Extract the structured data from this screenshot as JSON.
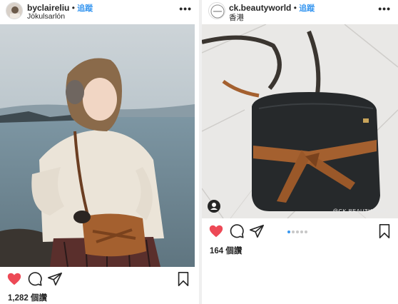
{
  "posts": [
    {
      "username": "byclaireliu",
      "follow_label": "追蹤",
      "location": "Jökulsarlón",
      "likes": "1,282 個讚",
      "icons": [
        "heart-filled-icon",
        "comment-icon",
        "share-icon",
        "bookmark-icon",
        "more-icon"
      ]
    },
    {
      "username": "ck.beautyworld",
      "follow_label": "追蹤",
      "location": "香港",
      "likes": "164 個讚",
      "watermark": "@CK.BEAUTYWORLD",
      "carousel": {
        "count": 5,
        "active_index": 0
      },
      "icons": [
        "heart-filled-icon",
        "comment-icon",
        "share-icon",
        "bookmark-icon",
        "more-icon",
        "user-tag-icon"
      ]
    }
  ],
  "colors": {
    "like_red": "#ed4956",
    "follow_blue": "#3897f0",
    "text": "#262626",
    "divider": "#efefef"
  }
}
